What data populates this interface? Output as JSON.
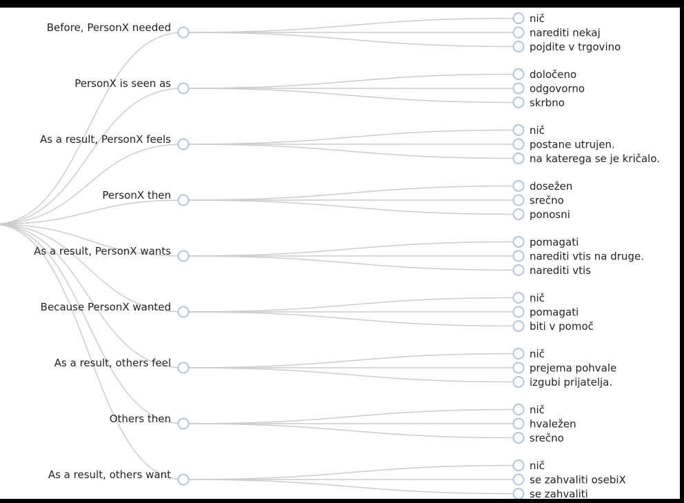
{
  "colors": {
    "link": "#cccccc",
    "node_stroke": "#b0c4de",
    "node_fill": "#ffffff",
    "text": "#222222",
    "frame": "#000000"
  },
  "tree": {
    "categories": [
      {
        "label": "Before, PersonX needed",
        "children": [
          "nič",
          "narediti nekaj",
          "pojdite v trgovino"
        ]
      },
      {
        "label": "PersonX is seen as",
        "children": [
          "določeno",
          "odgovorno",
          "skrbno"
        ]
      },
      {
        "label": "As a result, PersonX feels",
        "children": [
          "nič",
          "postane utrujen.",
          "na katerega se je kričalo."
        ]
      },
      {
        "label": "PersonX then",
        "children": [
          "dosežen",
          "srečno",
          "ponosni"
        ]
      },
      {
        "label": "As a result, PersonX wants",
        "children": [
          "pomagati",
          "narediti vtis na druge.",
          "narediti vtis"
        ]
      },
      {
        "label": "Because PersonX wanted",
        "children": [
          "nič",
          "pomagati",
          "biti v pomoč"
        ]
      },
      {
        "label": "As a result, others feel",
        "children": [
          "nič",
          "prejema pohvale",
          "izgubi prijatelja."
        ]
      },
      {
        "label": "Others then",
        "children": [
          "nič",
          "hvaležen",
          "srečno"
        ]
      },
      {
        "label": "As a result, others want",
        "children": [
          "nič",
          "se zahvaliti osebiX",
          "se zahvaliti"
        ]
      }
    ]
  }
}
